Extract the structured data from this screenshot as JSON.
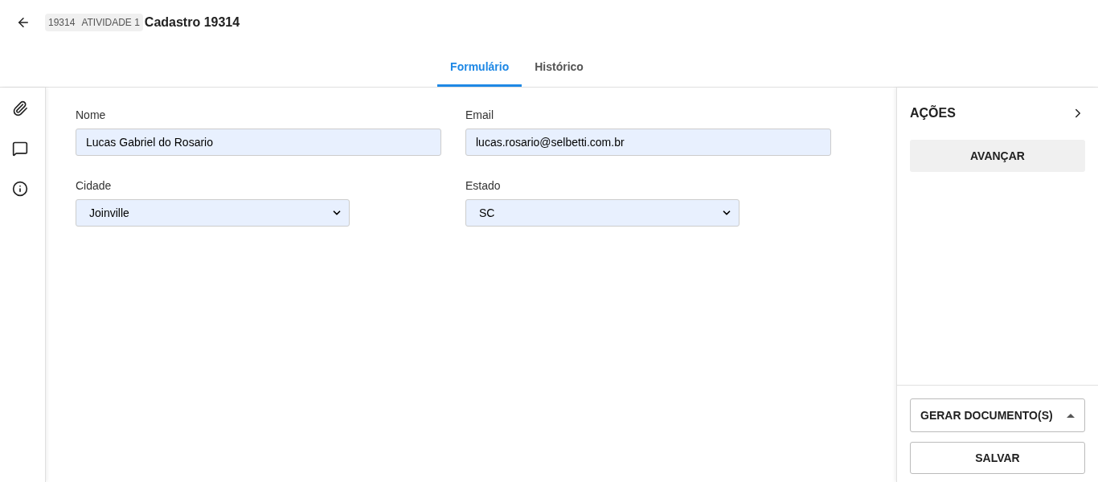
{
  "header": {
    "id_badge": "19314",
    "activity_badge": "ATIVIDADE 1",
    "title": "Cadastro 19314"
  },
  "tabs": [
    {
      "label": "Formulário",
      "selected": true
    },
    {
      "label": "Histórico",
      "selected": false
    }
  ],
  "form": {
    "rows": [
      [
        {
          "label": "Nome",
          "kind": "text",
          "value": "Lucas Gabriel do Rosario"
        },
        {
          "label": "Email",
          "kind": "text",
          "value": "lucas.rosario@selbetti.com.br"
        }
      ],
      [
        {
          "label": "Cidade",
          "kind": "select",
          "value": "Joinville"
        },
        {
          "label": "Estado",
          "kind": "select",
          "value": "SC"
        }
      ]
    ]
  },
  "actions": {
    "title": "AÇÕES",
    "buttons": [
      "AVANÇAR"
    ],
    "generate_label": "GERAR DOCUMENTO(S)",
    "save_label": "SALVAR"
  }
}
